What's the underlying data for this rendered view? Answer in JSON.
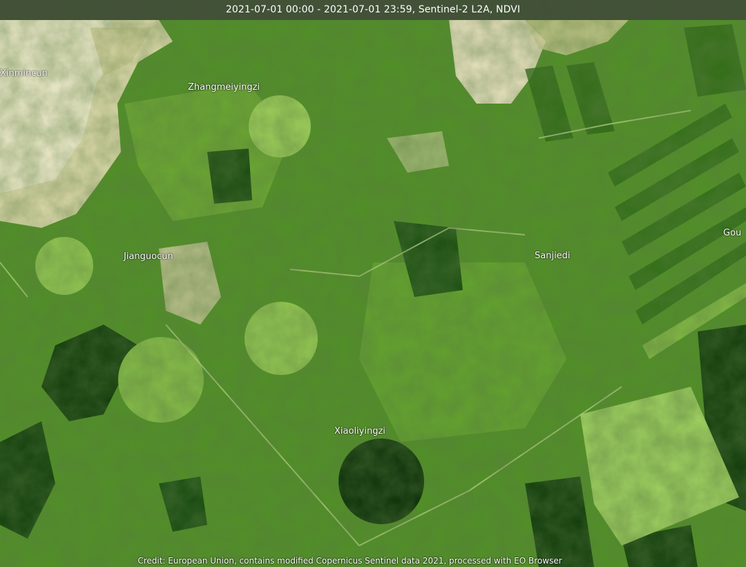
{
  "header": {
    "title": "2021-07-01 00:00 - 2021-07-01 23:59, Sentinel-2 L2A, NDVI"
  },
  "places": [
    {
      "key": "xinmincun",
      "label": "Xinmincun"
    },
    {
      "key": "zhangmeiyingzi",
      "label": "Zhangmeiyingzi"
    },
    {
      "key": "jianguocun",
      "label": "Jianguocun"
    },
    {
      "key": "sanjiedi",
      "label": "Sanjiedi"
    },
    {
      "key": "gou",
      "label": "Gou"
    },
    {
      "key": "xiaoliyingzi",
      "label": "Xiaoliyingzi"
    }
  ],
  "credit": "Credit: European Union, contains modified Copernicus Sentinel data 2021, processed with EO Browser",
  "colors": {
    "bare_soil": "#e8e2b8",
    "sparse_veg": "#8cbf45",
    "medium_veg": "#4d8f1f",
    "dense_veg": "#0f3d0a"
  }
}
